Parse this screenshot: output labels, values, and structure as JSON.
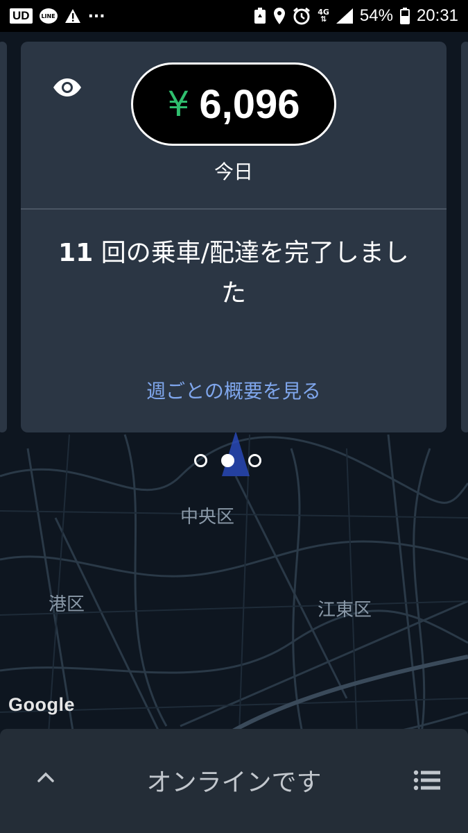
{
  "statusbar": {
    "app_ud": "UD",
    "app_line": "LINE",
    "more": "...",
    "network": "4G",
    "battery": "54%",
    "time": "20:31"
  },
  "map": {
    "labels": [
      "中央区",
      "港区",
      "江東区"
    ],
    "attribution": "Google"
  },
  "card": {
    "currency_symbol": "¥",
    "amount": "6,096",
    "period": "今日",
    "trip_count": "11",
    "trip_summary_rest": " 回の乗車/配達を完了しました",
    "weekly_link": "週ごとの概要を見る",
    "icon": "eye-icon"
  },
  "pager": {
    "count": 3,
    "active_index": 1
  },
  "bottombar": {
    "status": "オンラインです",
    "left_icon": "chevron-up-icon",
    "right_icon": "list-menu-icon"
  },
  "colors": {
    "accent_green": "#2fbf6e",
    "link_blue": "#7fa6ec",
    "card_bg": "#2b3644",
    "map_bg": "#0e1620"
  }
}
